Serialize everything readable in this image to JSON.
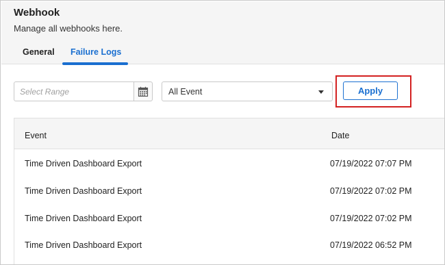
{
  "header": {
    "title": "Webhook",
    "subtitle": "Manage all webhooks here.",
    "tabs": [
      {
        "label": "General",
        "active": false
      },
      {
        "label": "Failure Logs",
        "active": true
      }
    ]
  },
  "filters": {
    "range_placeholder": "Select Range",
    "range_icon": "calendar-icon",
    "event_selected": "All Event",
    "apply_label": "Apply"
  },
  "table": {
    "columns": [
      "Event",
      "Date"
    ],
    "rows": [
      {
        "event": "Time Driven Dashboard Export",
        "date": "07/19/2022 07:07 PM"
      },
      {
        "event": "Time Driven Dashboard Export",
        "date": "07/19/2022 07:02 PM"
      },
      {
        "event": "Time Driven Dashboard Export",
        "date": "07/19/2022 07:02 PM"
      },
      {
        "event": "Time Driven Dashboard Export",
        "date": "07/19/2022 06:52 PM"
      }
    ]
  },
  "colors": {
    "accent": "#1a6fd0",
    "highlight": "#d32020",
    "header_bg": "#f5f5f5"
  }
}
